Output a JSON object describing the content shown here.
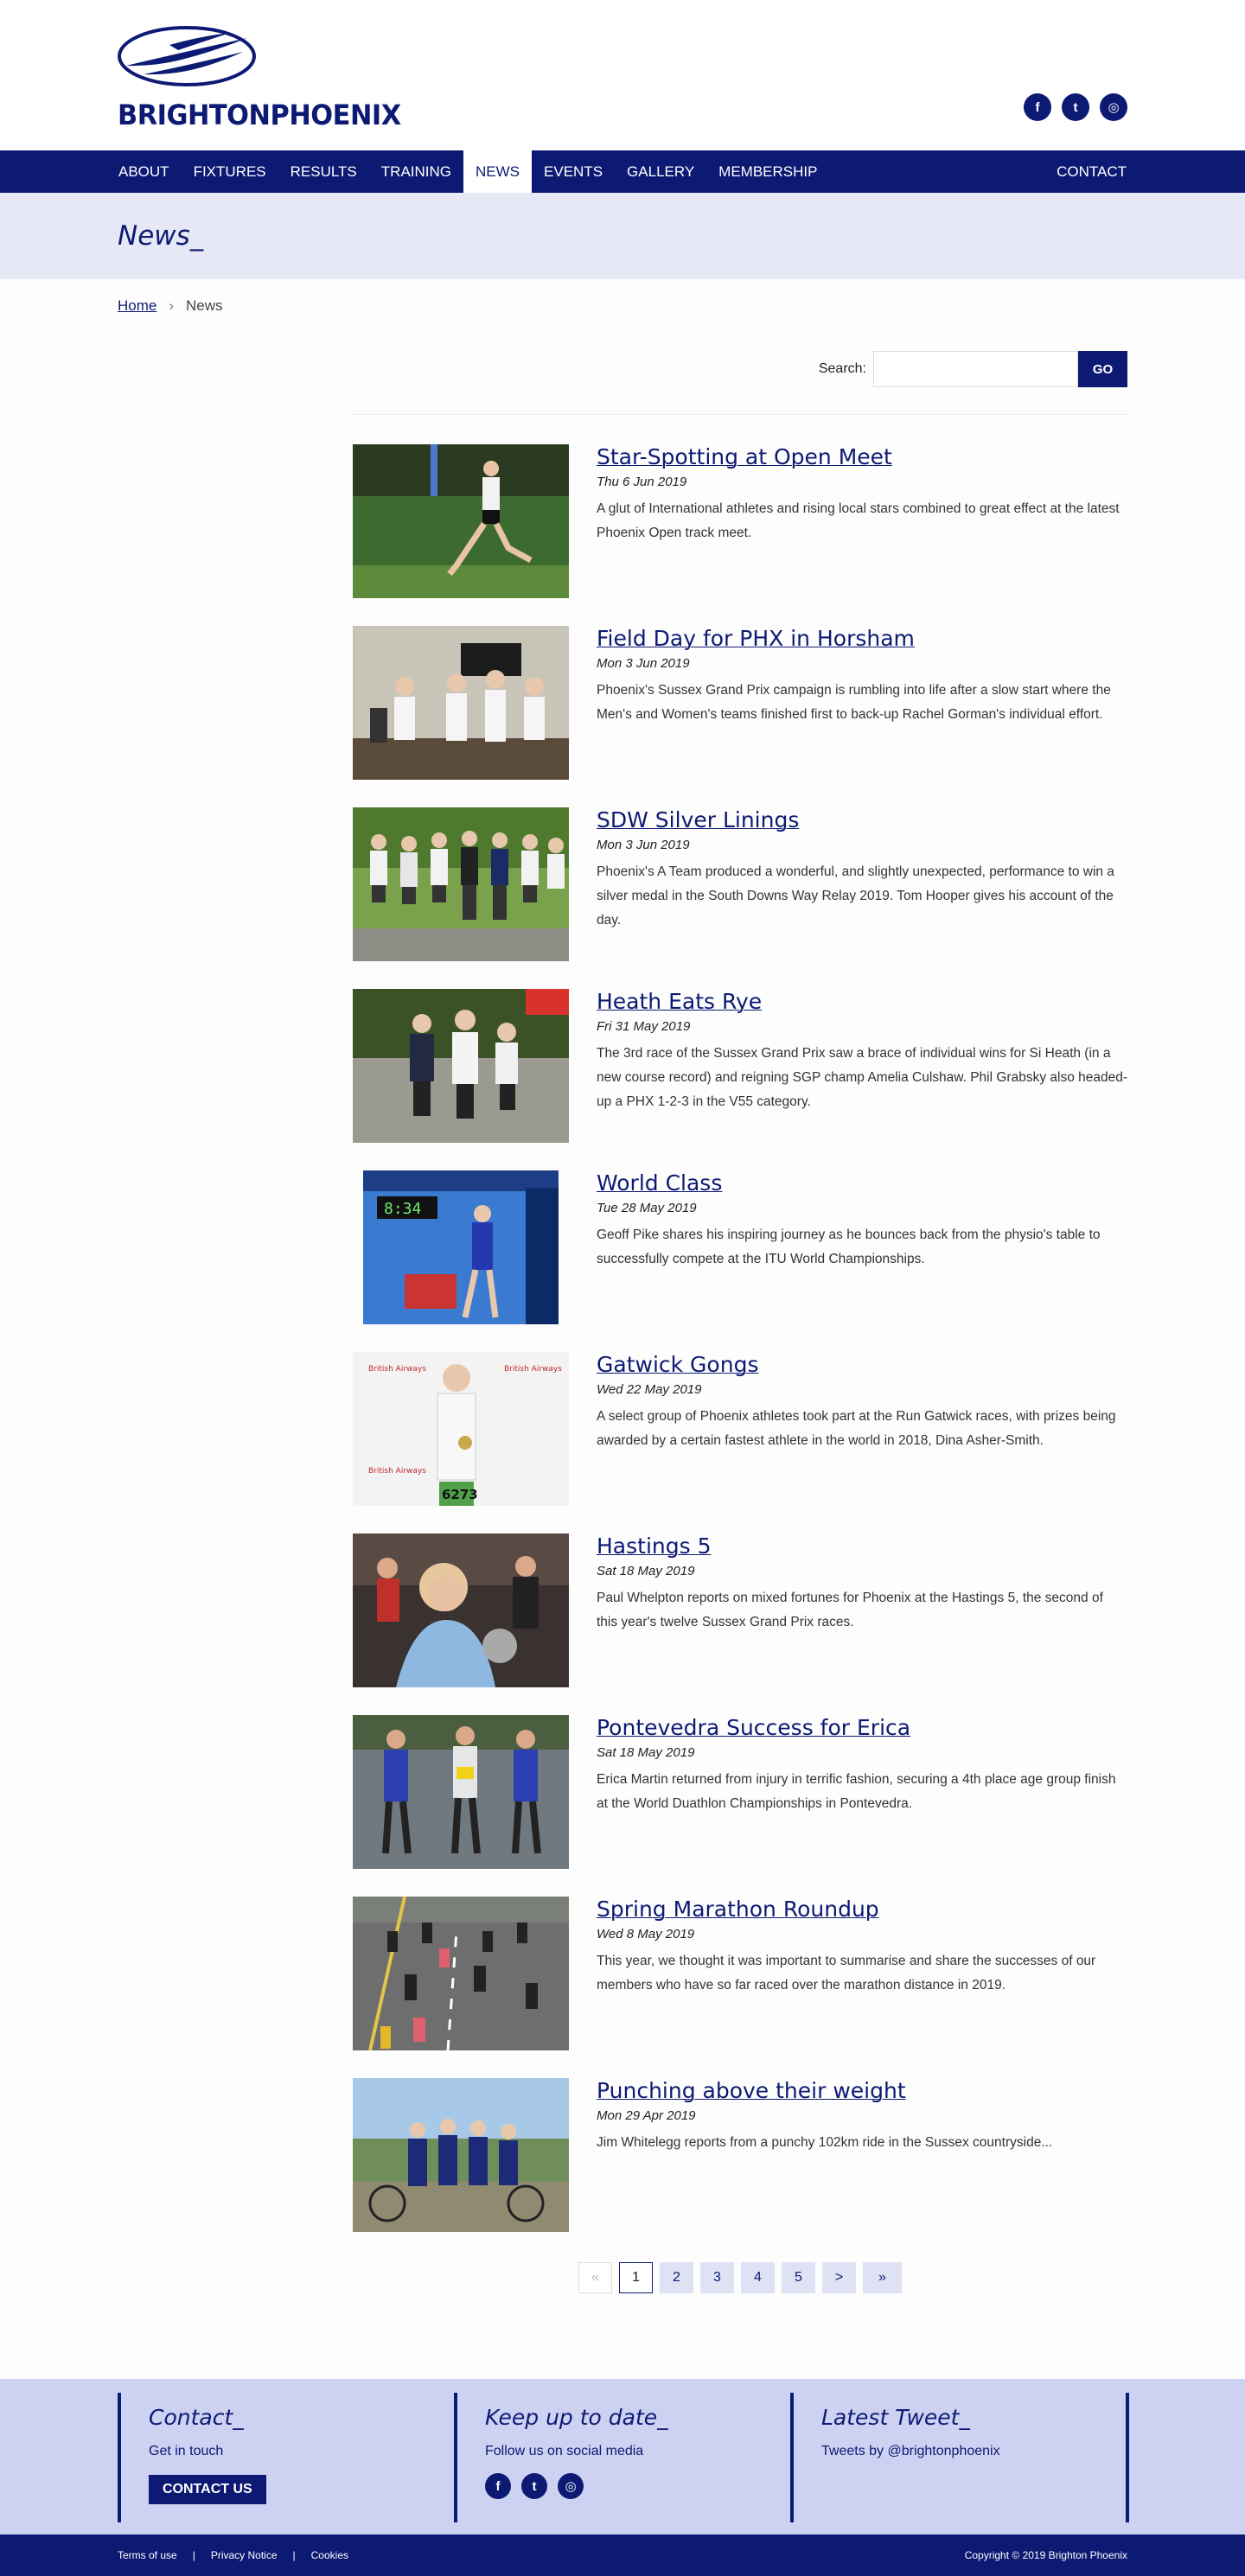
{
  "brand": {
    "name": "BRIGHTONPHOENIX"
  },
  "colors": {
    "primary": "#0d1a73",
    "band": "#e6e8f6",
    "footer": "#cdd2f3"
  },
  "social": [
    {
      "icon": "facebook-icon",
      "glyph": "f"
    },
    {
      "icon": "twitter-icon",
      "glyph": "t"
    },
    {
      "icon": "instagram-icon",
      "glyph": "◎"
    }
  ],
  "nav": {
    "items": [
      "ABOUT",
      "FIXTURES",
      "RESULTS",
      "TRAINING",
      "NEWS",
      "EVENTS",
      "GALLERY",
      "MEMBERSHIP"
    ],
    "active": "NEWS",
    "contact": "CONTACT"
  },
  "page": {
    "title": "News_"
  },
  "breadcrumb": {
    "home": "Home",
    "separator": "›",
    "current": "News"
  },
  "search": {
    "label": "Search:",
    "placeholder": "",
    "button": "GO"
  },
  "articles": [
    {
      "title": "Star-Spotting at Open Meet",
      "date": "Thu 6 Jun 2019",
      "summary": "A glut of International athletes and rising local stars combined to great effect at the latest Phoenix Open track meet."
    },
    {
      "title": "Field Day for PHX in Horsham",
      "date": "Mon 3 Jun 2019",
      "summary": "Phoenix's Sussex Grand Prix campaign is rumbling into life after a slow start where the Men's and Women's teams finished first to back-up Rachel Gorman's individual effort."
    },
    {
      "title": "SDW Silver Linings",
      "date": "Mon 3 Jun 2019",
      "summary": "Phoenix's A Team produced a wonderful, and slightly unexpected, performance to win a silver medal in the South Downs Way Relay 2019. Tom Hooper gives his account of the day."
    },
    {
      "title": "Heath Eats Rye",
      "date": "Fri 31 May 2019",
      "summary": "The 3rd race of the Sussex Grand Prix saw a brace of individual wins for Si Heath (in a new course record) and reigning SGP champ Amelia Culshaw. Phil Grabsky also headed-up a PHX 1-2-3 in the V55 category."
    },
    {
      "title": "World Class",
      "date": "Tue 28 May 2019",
      "summary": "Geoff Pike shares his inspiring journey as he bounces back from the physio's table to successfully compete at the ITU World Championships."
    },
    {
      "title": "Gatwick Gongs",
      "date": "Wed 22 May 2019",
      "summary": "A select group of Phoenix athletes took part at the Run Gatwick races, with prizes being awarded by a certain fastest athlete in the world in 2018, Dina Asher-Smith."
    },
    {
      "title": "Hastings 5",
      "date": "Sat 18 May 2019",
      "summary": "Paul Whelpton reports on mixed fortunes for Phoenix at the Hastings 5, the second of this year's twelve Sussex Grand Prix races."
    },
    {
      "title": "Pontevedra Success for Erica",
      "date": "Sat 18 May 2019",
      "summary": "Erica Martin returned from injury in terrific fashion, securing a 4th place age group finish at the World Duathlon Championships in Pontevedra."
    },
    {
      "title": "Spring Marathon Roundup",
      "date": "Wed 8 May 2019",
      "summary": "This year, we thought it was important to summarise and share the successes of our members who have so far raced over the marathon distance in 2019."
    },
    {
      "title": "Punching above their weight",
      "date": "Mon 29 Apr 2019",
      "summary": "Jim Whitelegg reports from a punchy 102km ride in the Sussex countryside..."
    }
  ],
  "thumb_text": {
    "clock": "8:34",
    "sign": "British Airways",
    "bib": "6273"
  },
  "pagination": {
    "first": "«",
    "pages": [
      "1",
      "2",
      "3",
      "4",
      "5"
    ],
    "current": "1",
    "next": ">",
    "last": "»"
  },
  "footer": {
    "contact": {
      "title": "Contact_",
      "text": "Get in touch",
      "button": "CONTACT US"
    },
    "updates": {
      "title": "Keep up to date_",
      "text": "Follow us on social media"
    },
    "tweet": {
      "title": "Latest Tweet_",
      "text": "Tweets by @brightonphoenix"
    }
  },
  "bottom": {
    "links": [
      "Terms of use",
      "Privacy Notice",
      "Cookies"
    ],
    "separator": "|",
    "copyright": "Copyright © 2019 Brighton Phoenix"
  }
}
